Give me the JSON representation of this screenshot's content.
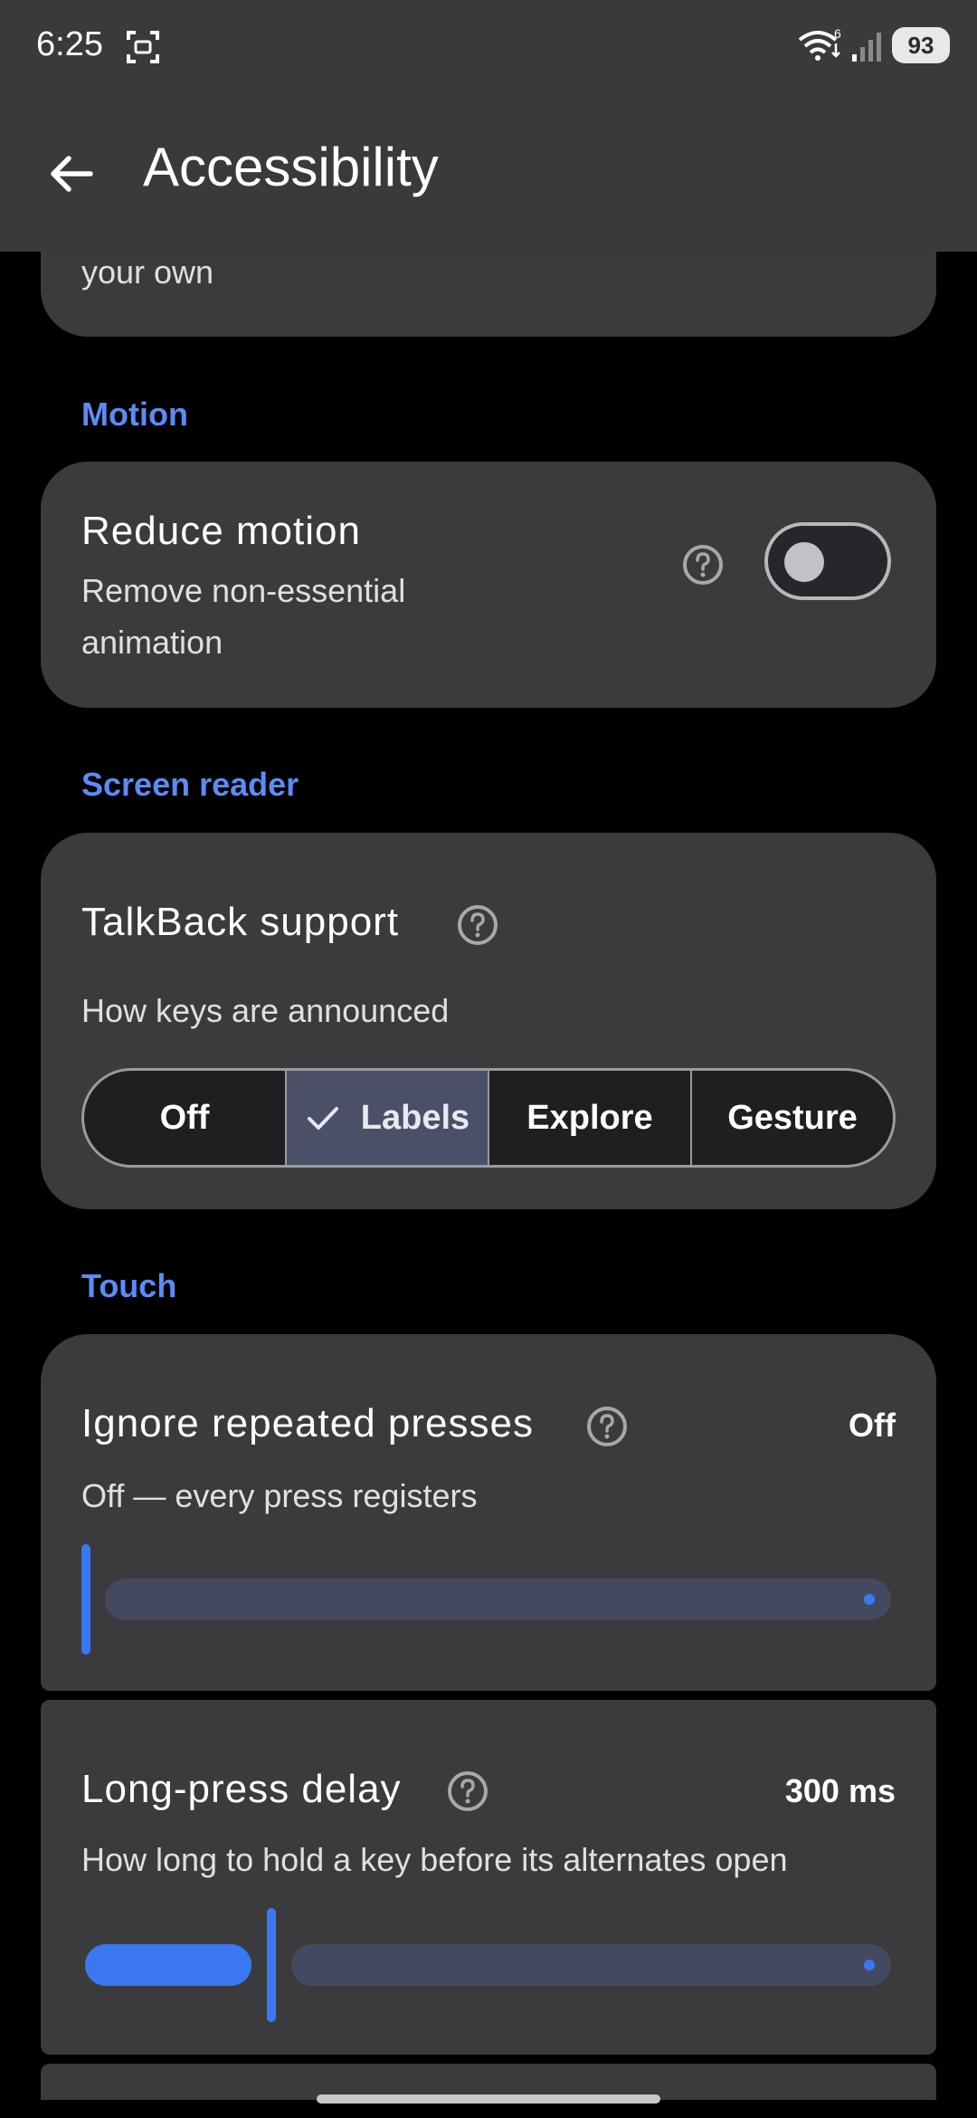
{
  "status_bar": {
    "time": "6:25",
    "battery": "93",
    "icons": [
      "screenshot-icon",
      "wifi-icon",
      "signal-icon"
    ]
  },
  "app_bar": {
    "title": "Accessibility",
    "back_icon": "arrow-left-icon"
  },
  "partial_card": {
    "text": "your own"
  },
  "motion": {
    "header": "Motion",
    "reduce_motion": {
      "title": "Reduce motion",
      "subtitle_line1": "Remove non-essential",
      "subtitle_line2": "animation",
      "enabled": false
    }
  },
  "screen_reader": {
    "header": "Screen reader",
    "talkback": {
      "title": "TalkBack support",
      "subtitle": "How keys are announced",
      "options": [
        "Off",
        "Labels",
        "Explore",
        "Gesture"
      ],
      "selected": "Labels"
    }
  },
  "touch": {
    "header": "Touch",
    "ignore_repeated": {
      "title": "Ignore repeated presses",
      "value": "Off",
      "subtitle": "Off — every press registers",
      "level": 0
    },
    "long_press": {
      "title": "Long-press delay",
      "value": "300 ms",
      "subtitle": "How long to hold a key before its alternates open",
      "level": 0.24
    }
  },
  "colors": {
    "accent": "#3a78f2",
    "section_header": "#5b8cf5",
    "card": "#3b3b3d",
    "background": "#000000"
  }
}
